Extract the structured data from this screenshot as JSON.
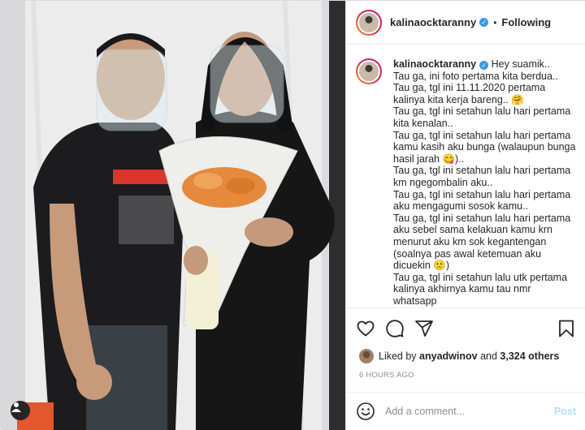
{
  "post": {
    "username": "kalinaocktaranny",
    "verified_mark": "✓",
    "separator": "•",
    "follow_status": "Following",
    "caption": {
      "username": "kalinaocktaranny",
      "text": "Hey suamik..\nTau ga, ini foto pertama kita berdua..\nTau ga, tgl ini 11.11.2020 pertama kalinya kita kerja bareng.. 🤗\nTau ga, tgl ini setahun lalu hari pertama kita kenalan..\nTau ga, tgl ini setahun lalu hari pertama kamu kasih aku bunga (walaupun bunga hasil jarah 😋)..\nTau ga, tgl ini setahun lalu hari pertama km ngegombalin aku..\nTau ga, tgl ini setahun lalu hari pertama aku mengagumi sosok kamu..\nTau ga, tgl ini setahun lalu hari pertama aku sebel sama kelakuan kamu krn menurut aku km sok kegantengan (soalnya pas awal ketemuan aku dicuekin 🙁)\nTau ga, tgl ini setahun lalu utk pertama kalinya akhirnya kamu tau nmr whatsapp"
    },
    "likes": {
      "prefix": "Liked by",
      "liker": "anyadwinov",
      "joiner": "and",
      "others": "3,324 others"
    },
    "timestamp": "6 HOURS AGO",
    "comment": {
      "placeholder": "Add a comment...",
      "post_label": "Post"
    },
    "icons": [
      "heart-icon",
      "comment-icon",
      "share-icon",
      "bookmark-icon",
      "emoji-icon",
      "user-tag-icon"
    ],
    "colors": {
      "verified": "#3897f0",
      "post_disabled": "#b2dffc",
      "muted": "#8e8e8e"
    }
  }
}
